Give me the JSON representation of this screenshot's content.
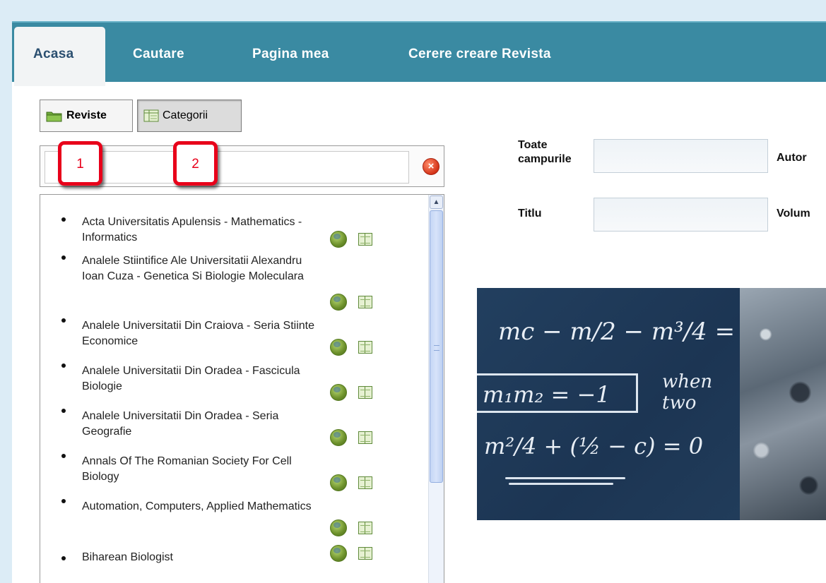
{
  "nav": {
    "tabs": [
      {
        "label": "Acasa",
        "active": true
      },
      {
        "label": "Cautare"
      },
      {
        "label": "Pagina mea"
      },
      {
        "label": "Cerere creare Revista"
      }
    ]
  },
  "toggles": {
    "reviste": {
      "label": "Reviste",
      "icon": "folder-icon",
      "pressed": false
    },
    "categorii": {
      "label": "Categorii",
      "icon": "table-icon",
      "pressed": true
    }
  },
  "search": {
    "value": "",
    "placeholder": ""
  },
  "journals": [
    {
      "name": "Acta Universitatis Apulensis - Mathematics - Informatics"
    },
    {
      "name": "Analele Stiintifice Ale Universitatii Alexandru Ioan Cuza - Genetica Si Biologie Moleculara"
    },
    {
      "name": "Analele Universitatii Din Craiova - Seria Stiinte Economice"
    },
    {
      "name": "Analele Universitatii Din Oradea - Fascicula Biologie"
    },
    {
      "name": "Analele Universitatii Din Oradea - Seria Geografie"
    },
    {
      "name": "Annals Of The Romanian Society For Cell Biology"
    },
    {
      "name": "Automation, Computers, Applied Mathematics"
    },
    {
      "name": "Biharean Biologist"
    }
  ],
  "form": {
    "toate_label": "Toate campurile",
    "autor_label": "Autor",
    "titlu_label": "Titlu",
    "volum_label": "Volum",
    "toate_value": "",
    "titlu_value": ""
  },
  "banner": {
    "eq1": "mc − m/2 − m³/4 =",
    "eq2": "m₁m₂ = −1",
    "eq2_side": "when two",
    "eq3": "m²/4 + (½ − c) = 0"
  },
  "annotations": [
    {
      "label": "1"
    },
    {
      "label": "2"
    }
  ],
  "colors": {
    "nav": "#3a8aa2",
    "active_tab_text": "#2b4f70",
    "annotation": "#e8001a"
  }
}
